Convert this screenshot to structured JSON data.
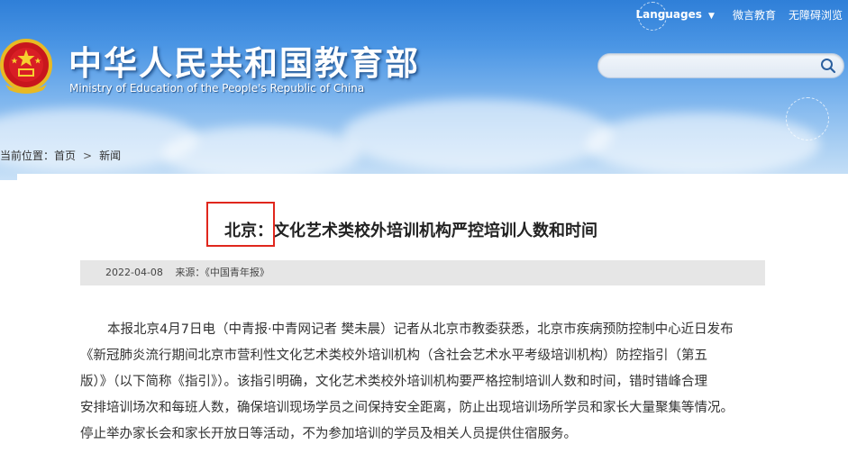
{
  "header": {
    "languages_label": "Languages",
    "weibo_label": "微言教育",
    "accessibility_label": "无障碍浏览",
    "title_cn": "中华人民共和国教育部",
    "title_en": "Ministry of Education of the People's Republic of China",
    "search_placeholder": ""
  },
  "breadcrumb": {
    "prefix": "当前位置：",
    "home": "首页",
    "separator": ">",
    "current": "新闻"
  },
  "article": {
    "headline_prefix": "北京：",
    "headline_rest": "文化艺术类校外培训机构严控培训人数和时间",
    "date": "2022-04-08",
    "source": "来源：《中国青年报》",
    "paragraph_lines": [
      "本报北京4月7日电（中青报·中青网记者 樊未晨）记者从北京市教委获悉，北京市疾病预防控制中心近日发布",
      "《新冠肺炎流行期间北京市营利性文化艺术类校外培训机构（含社会艺术水平考级培训机构）防控指引（第五",
      "版）》（以下简称《指引》）。该指引明确，文化艺术类校外培训机构要严格控制培训人数和时间，错时错峰合理",
      "安排培训场次和每班人数，确保培训现场学员之间保持安全距离，防止出现培训场所学员和家长大量聚集等情况。",
      "停止举办家长会和家长开放日等活动，不为参加培训的学员及相关人员提供住宿服务。"
    ]
  },
  "colors": {
    "header_blue": "#2f7fd8",
    "highlight_red": "#e0271d",
    "meta_bar_gray": "#e6e6e6"
  },
  "icons": {
    "emblem": "national-emblem-icon",
    "search": "search-icon",
    "caret": "chevron-down-icon"
  }
}
